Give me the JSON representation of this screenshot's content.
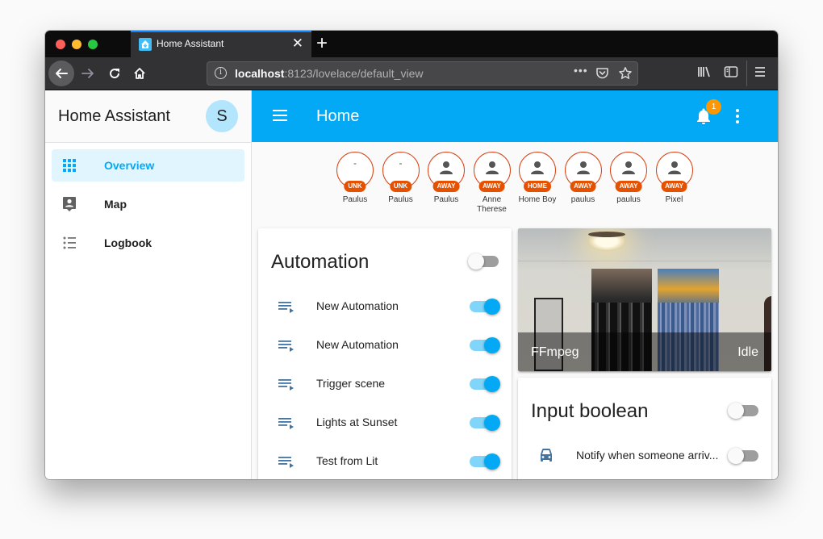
{
  "browser": {
    "tab_title": "Home Assistant",
    "url_host": "localhost",
    "url_rest": ":8123/lovelace/default_view",
    "url_more": "•••"
  },
  "sidebar": {
    "title": "Home Assistant",
    "avatar_initial": "S",
    "items": [
      {
        "label": "Overview",
        "icon": "view-dashboard-icon",
        "active": true
      },
      {
        "label": "Map",
        "icon": "account-location-icon",
        "active": false
      },
      {
        "label": "Logbook",
        "icon": "format-list-bulleted-icon",
        "active": false
      }
    ]
  },
  "header": {
    "title": "Home",
    "notification_count": "1"
  },
  "badges": [
    {
      "state": "UNK",
      "name": "Paulus",
      "icon": "-"
    },
    {
      "state": "UNK",
      "name": "Paulus",
      "icon": "-"
    },
    {
      "state": "AWAY",
      "name": "Paulus",
      "icon": "person"
    },
    {
      "state": "AWAY",
      "name": "Anne Therese",
      "icon": "person"
    },
    {
      "state": "HOME",
      "name": "Home Boy",
      "icon": "person"
    },
    {
      "state": "AWAY",
      "name": "paulus",
      "icon": "person"
    },
    {
      "state": "AWAY",
      "name": "paulus",
      "icon": "person"
    },
    {
      "state": "AWAY",
      "name": "Pixel",
      "icon": "person"
    }
  ],
  "automation_card": {
    "title": "Automation",
    "master_toggle": false,
    "rows": [
      {
        "label": "New Automation",
        "on": true
      },
      {
        "label": "New Automation",
        "on": true
      },
      {
        "label": "Trigger scene",
        "on": true
      },
      {
        "label": "Lights at Sunset",
        "on": true
      },
      {
        "label": "Test from Lit",
        "on": true
      }
    ]
  },
  "camera_card": {
    "name": "FFmpeg",
    "state": "Idle"
  },
  "input_boolean_card": {
    "title": "Input boolean",
    "master_toggle": false,
    "rows": [
      {
        "label": "Notify when someone arriv...",
        "on": false,
        "icon": "car-icon"
      }
    ]
  },
  "colors": {
    "primary": "#03a9f4",
    "badge_border": "#d84315",
    "badge_label": "#e65100",
    "notification_badge": "#ff9800",
    "sidebar_active_bg": "#e1f5fe"
  }
}
